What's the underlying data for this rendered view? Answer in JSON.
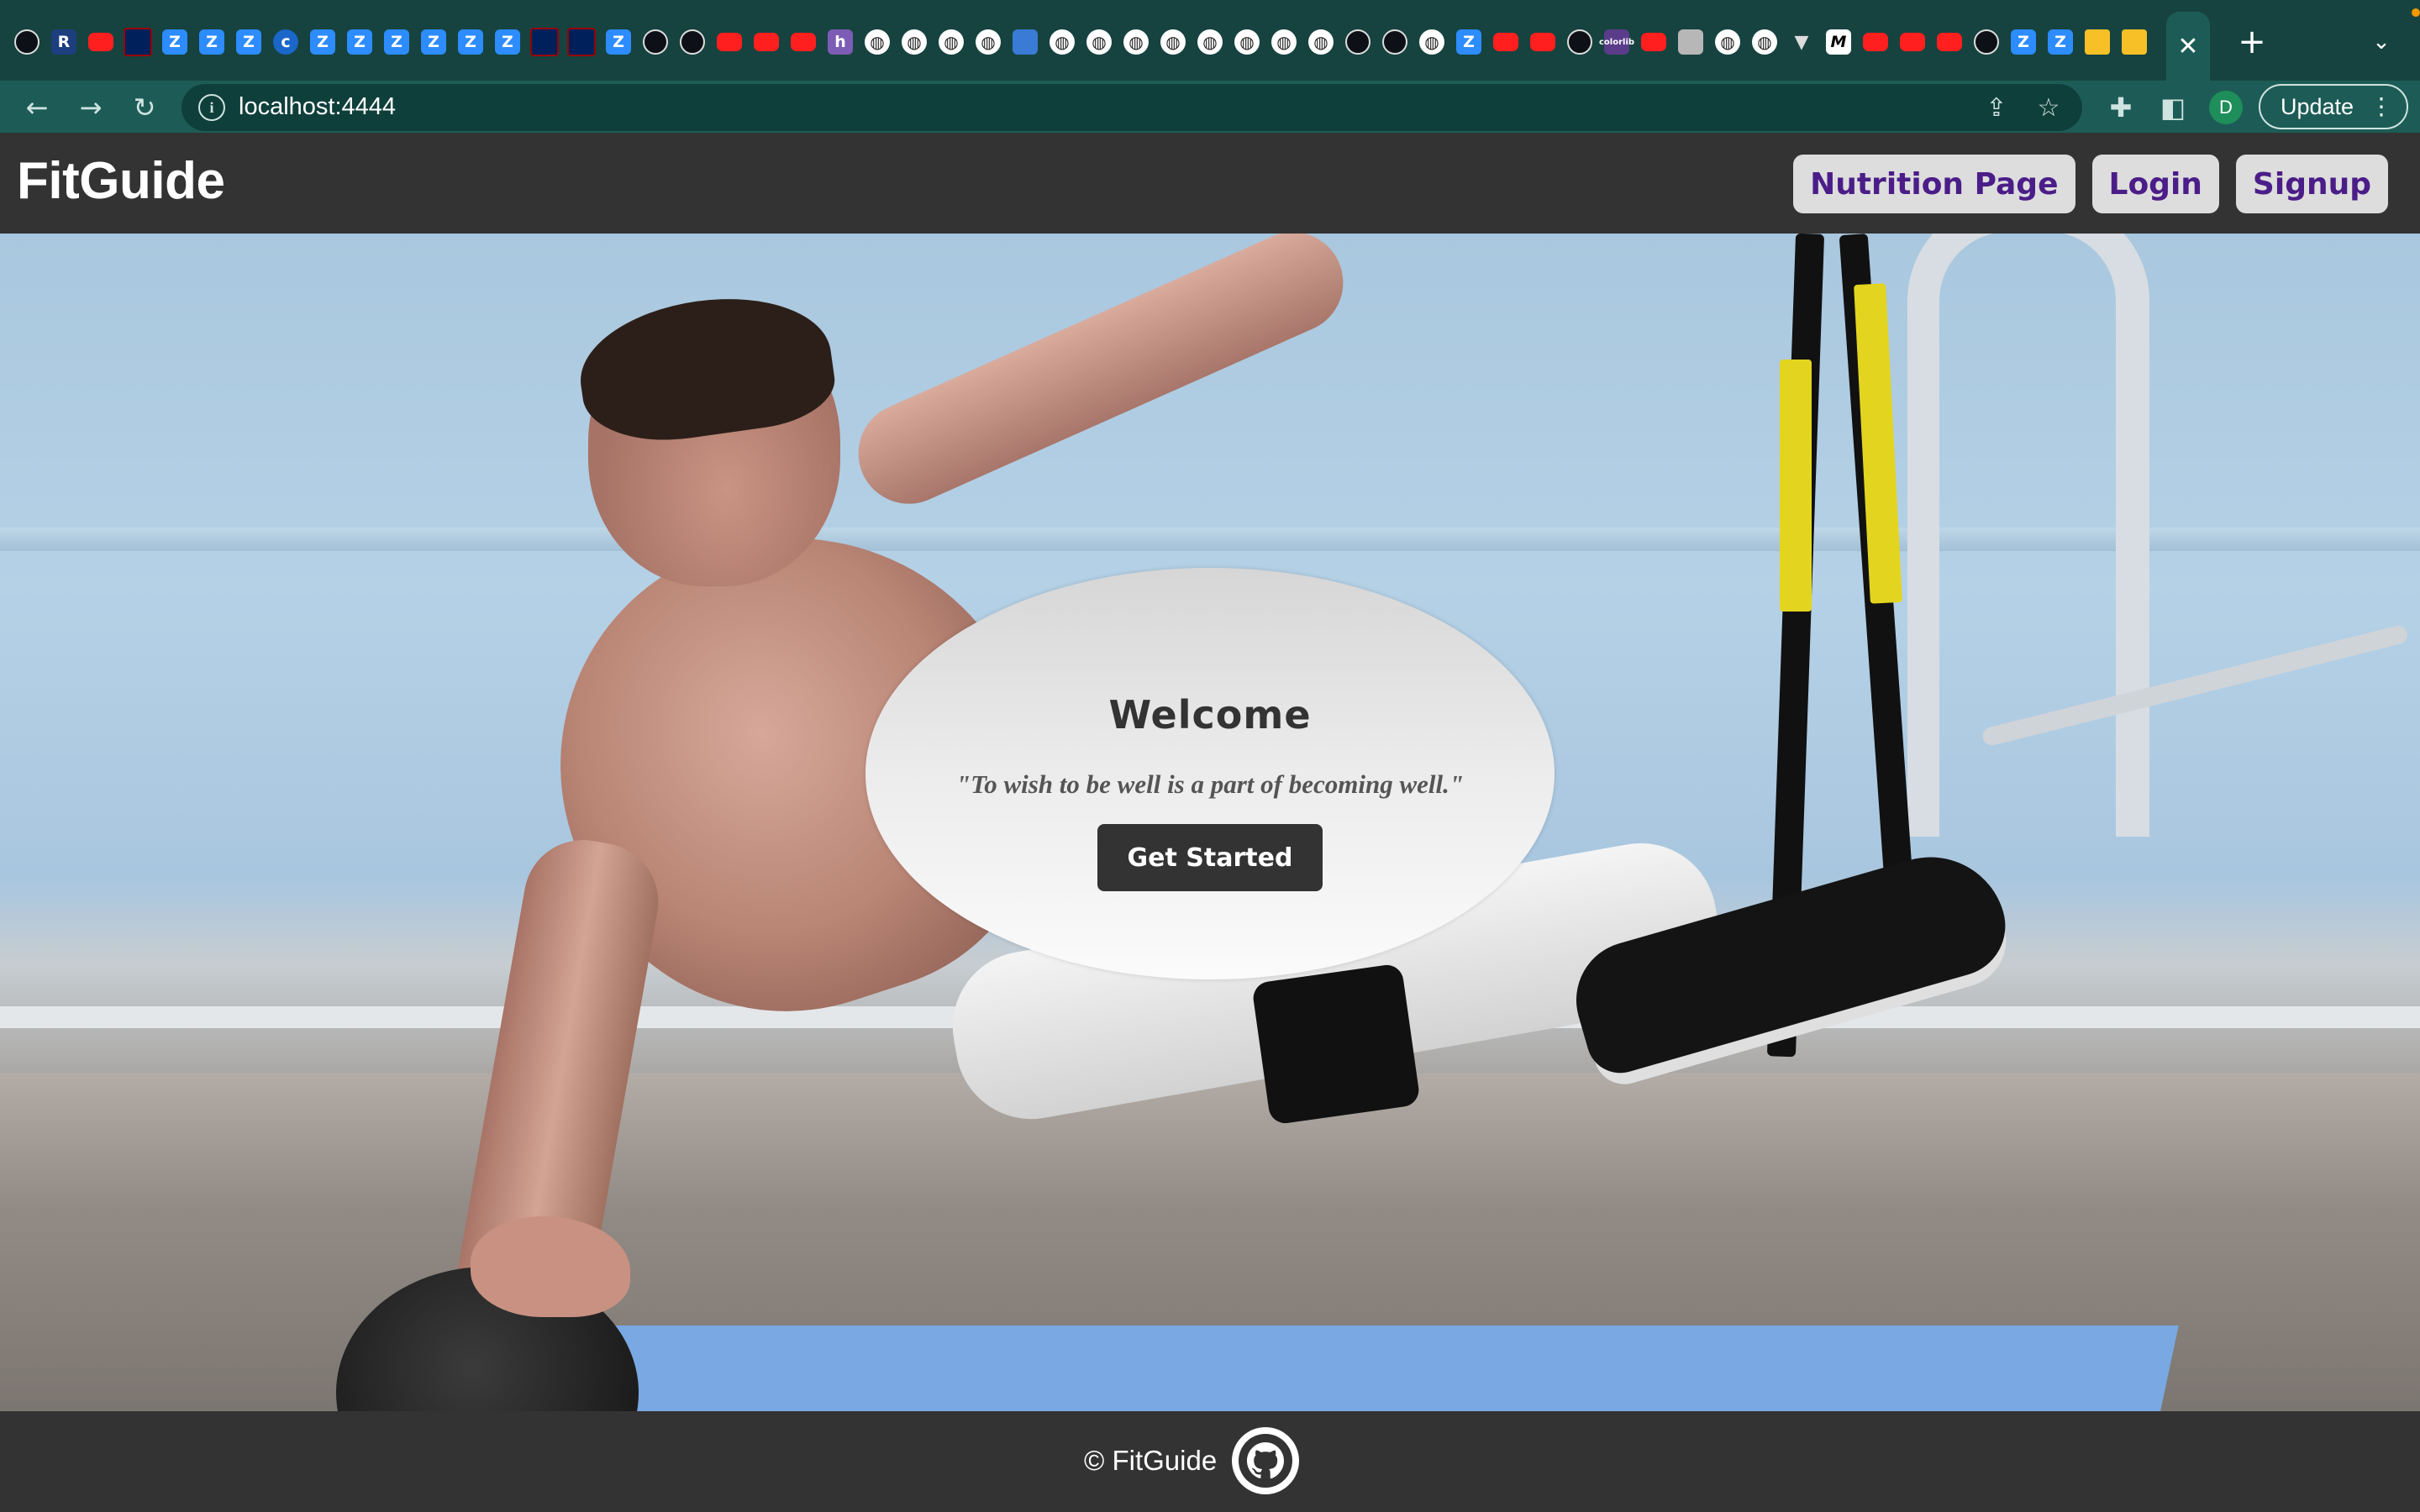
{
  "browser": {
    "tabs_favicons": [
      "github-icon",
      "r-icon",
      "youtube-icon",
      "penn-icon",
      "zoom-icon",
      "zoom-video-icon",
      "zoom-icon",
      "c-icon",
      "zoom-icon",
      "zoom-icon",
      "zoom-icon",
      "zoom-icon",
      "zoom-icon",
      "zoom-icon",
      "penn-icon",
      "penn-icon",
      "zoom-icon",
      "github-icon",
      "github-icon",
      "youtube-icon",
      "youtube-icon",
      "youtube-icon",
      "heroku-icon",
      "globe-icon",
      "globe-icon",
      "globe-icon",
      "globe-icon",
      "hex-icon",
      "globe-icon",
      "globe-icon",
      "globe-icon",
      "globe-icon",
      "globe-icon",
      "globe-icon",
      "globe-icon",
      "globe-icon",
      "github-icon",
      "github-icon",
      "chrome-icon",
      "zoom-icon",
      "youtube-icon",
      "youtube-icon",
      "github-icon",
      "colorlib-icon",
      "youtube-icon",
      "photo-icon",
      "globe-icon",
      "globe-icon",
      "vuetify-icon",
      "m-icon",
      "youtube-icon",
      "youtube-icon",
      "youtube-icon",
      "github-icon",
      "zoom-icon",
      "zoom-icon",
      "slides-icon",
      "slides-icon"
    ],
    "active_tab_close": "✕",
    "new_tab": "+",
    "tab_search": "⌄",
    "url": "localhost:4444",
    "profile_initial": "D",
    "update_label": "Update"
  },
  "app": {
    "brand": "FitGuide",
    "nav": {
      "nutrition": "Nutrition Page",
      "login": "Login",
      "signup": "Signup"
    },
    "hero": {
      "title": "Welcome",
      "quote": "\"To wish to be well is a part of becoming well.\"",
      "cta": "Get Started"
    },
    "footer": {
      "copyright": "© FitGuide"
    }
  },
  "colors": {
    "chrome_tabstrip": "#16433f",
    "chrome_toolbar": "#1d5c56",
    "header_bg": "#333333",
    "nav_button_bg": "#dddddd",
    "nav_button_text": "#4b1d88",
    "cta_bg": "#333333"
  }
}
